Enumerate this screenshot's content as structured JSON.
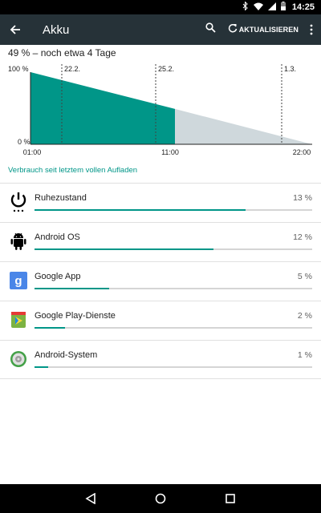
{
  "status_bar": {
    "time": "14:25",
    "icons": [
      "bluetooth-icon",
      "wifi-icon",
      "signal-icon",
      "battery-icon"
    ]
  },
  "app_bar": {
    "title": "Akku",
    "refresh_label": "AKTUALISIEREN",
    "icons": [
      "back-arrow-icon",
      "search-icon",
      "refresh-icon",
      "overflow-menu-icon"
    ]
  },
  "summary": "49 % – noch etwa 4 Tage",
  "chart_data": {
    "type": "area",
    "y_tick_labels": [
      "100 %",
      "0 %"
    ],
    "x_tick_labels": [
      "01:00",
      "11:00",
      "22:00"
    ],
    "date_markers": [
      "22.2.",
      "25.2.",
      "1.3."
    ],
    "series": [
      {
        "values": [
          100,
          49
        ],
        "color": "#009688"
      },
      {
        "values": [
          49,
          0
        ],
        "color": "#cfd8dc"
      }
    ],
    "ylim": [
      0,
      100
    ]
  },
  "section_header": "Verbrauch seit letztem vollen Aufladen",
  "apps": [
    {
      "label": "Ruhezustand",
      "percent": "13 %",
      "fraction": 0.76,
      "icon": "power-icon"
    },
    {
      "label": "Android OS",
      "percent": "12 %",
      "fraction": 0.645,
      "icon": "android-icon"
    },
    {
      "label": "Google App",
      "percent": "5 %",
      "fraction": 0.27,
      "icon": "google-app-icon"
    },
    {
      "label": "Google Play-Dienste",
      "percent": "2 %",
      "fraction": 0.11,
      "icon": "play-services-icon"
    },
    {
      "label": "Android-System",
      "percent": "1 %",
      "fraction": 0.05,
      "icon": "android-system-icon"
    }
  ],
  "nav_bar": {
    "icons": [
      "nav-back-icon",
      "nav-home-icon",
      "nav-recents-icon"
    ]
  },
  "colors": {
    "accent": "#009688",
    "app_bar": "#263238",
    "projection": "#cfd8dc"
  }
}
